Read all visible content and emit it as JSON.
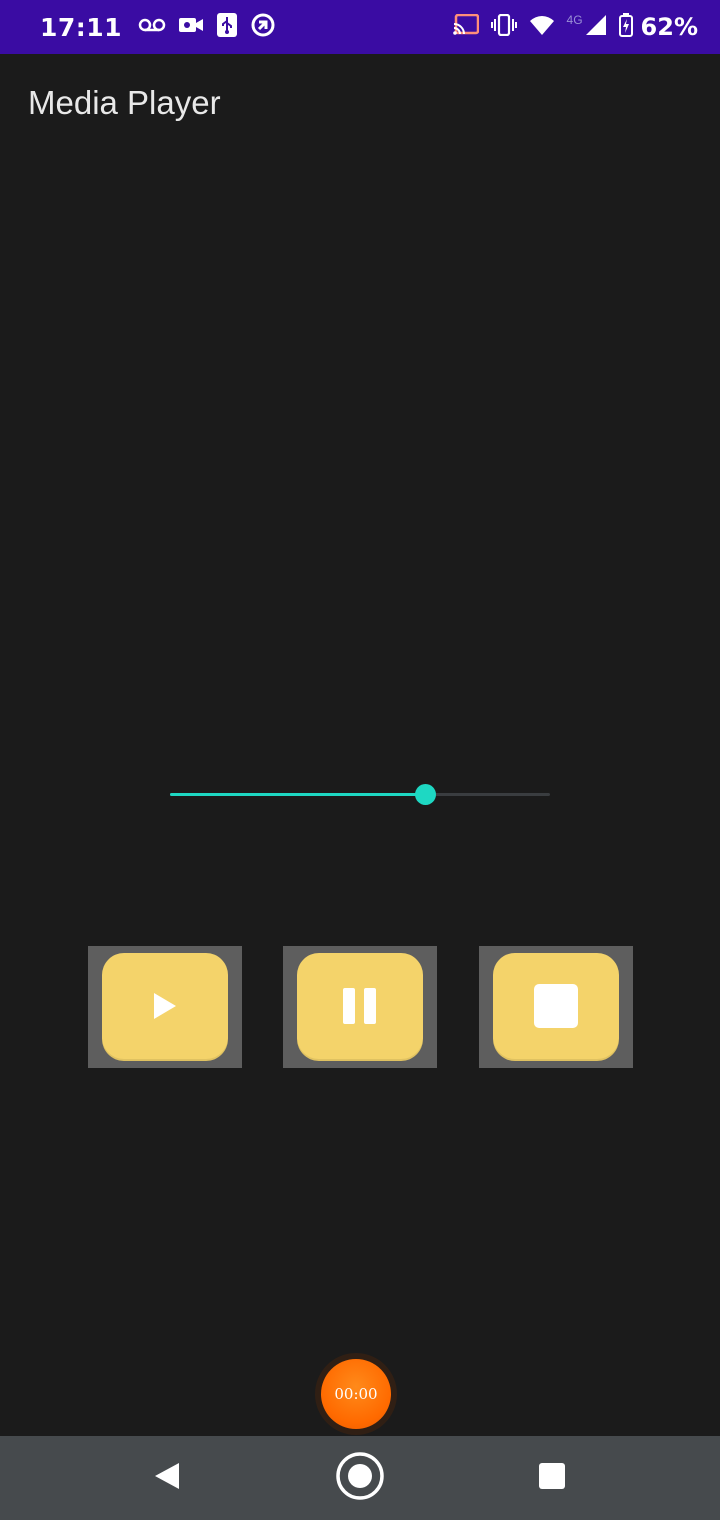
{
  "status_bar": {
    "time": "17:11",
    "network_label": "4G",
    "battery_percent": "62%",
    "left_icons": [
      "voicemail-icon",
      "video-camera-icon",
      "usb-icon",
      "vpn-icon"
    ],
    "right_icons": [
      "cast-icon",
      "vibrate-icon",
      "wifi-icon",
      "signal-icon",
      "battery-charging-icon"
    ]
  },
  "app": {
    "title": "Media Player"
  },
  "seekbar": {
    "progress": 0.67,
    "accent_color": "#1ed8c3"
  },
  "controls": [
    {
      "name": "play-button",
      "icon": "play-icon"
    },
    {
      "name": "pause-button",
      "icon": "pause-icon"
    },
    {
      "name": "stop-button",
      "icon": "stop-icon"
    }
  ],
  "timer": {
    "label": "00:00"
  },
  "navigation": {
    "buttons": [
      "back-icon",
      "home-icon",
      "recents-icon"
    ]
  },
  "colors": {
    "status_bar": "#3a0ca3",
    "background": "#1b1b1b",
    "button_fill": "#f4d36a",
    "button_frame": "#5e5e5e",
    "timer_fill": "#ff6a00",
    "nav_bar": "#464a4d"
  }
}
